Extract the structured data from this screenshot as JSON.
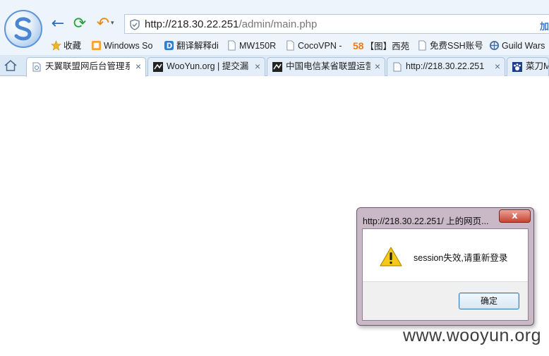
{
  "toolbar": {
    "back_icon": "←",
    "refresh_icon": "⟳",
    "undo_icon": "↶",
    "undo_caret": "▾"
  },
  "address_bar": {
    "url_host": "http://218.30.22.251",
    "url_path": "/admin/main.php",
    "add_label": "加"
  },
  "bookmarks": [
    {
      "label": "收藏",
      "icon": "star-icon"
    },
    {
      "label": "Windows So",
      "icon": "page-icon"
    },
    {
      "label": "翻译解释di",
      "icon": "dict-icon"
    },
    {
      "label": "MW150R",
      "icon": "page-icon"
    },
    {
      "label": "CocoVPN -",
      "icon": "page-icon"
    },
    {
      "label": "【图】西苑",
      "icon": "58-icon",
      "prefix": "58"
    },
    {
      "label": "免费SSH账号",
      "icon": "page-icon"
    },
    {
      "label": "Guild Wars",
      "icon": "guildwars-icon"
    }
  ],
  "tabs": [
    {
      "label": "天翼联盟网后台管理系",
      "active": true,
      "close": "×"
    },
    {
      "label": "WooYun.org | 提交漏",
      "active": false,
      "close": "×"
    },
    {
      "label": "中国电信某省联盟运营",
      "active": false,
      "close": "×"
    },
    {
      "label": "http://218.30.22.251",
      "active": false,
      "close": "×"
    },
    {
      "label": "菜刀M",
      "active": false,
      "close": ""
    }
  ],
  "dialog": {
    "title": "http://218.30.22.251/ 上的网页...",
    "close_label": "x",
    "message": "session失效,请重新登录",
    "ok_label": "确定"
  },
  "watermark": "www.wooyun.org",
  "colors": {
    "chrome_bg": "#eef4fb",
    "tab_bg": "#dbe8f6",
    "accent_blue": "#2b6cc4",
    "dialog_frame": "#c9b9c6"
  }
}
